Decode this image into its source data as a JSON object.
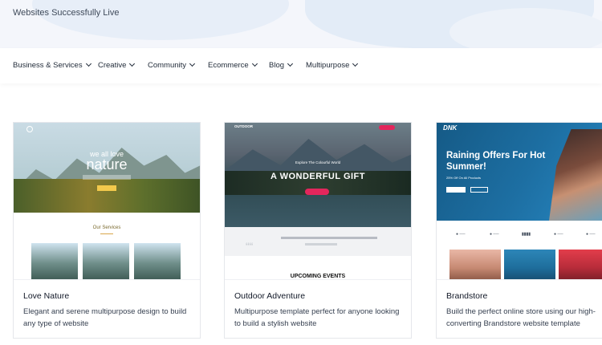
{
  "hero": {
    "text": "Websites Successfully Live"
  },
  "nav": {
    "items": [
      {
        "label": "Business & Services"
      },
      {
        "label": "Creative"
      },
      {
        "label": "Community"
      },
      {
        "label": "Ecommerce"
      },
      {
        "label": "Blog"
      },
      {
        "label": "Multipurpose"
      }
    ]
  },
  "cards": [
    {
      "title": "Love Nature",
      "description": "Elegant and serene multipurpose design to build any type of website",
      "preview": {
        "small": "we all love",
        "big": "nature",
        "section": "Our Services"
      }
    },
    {
      "title": "Outdoor Adventure",
      "description": "Multipurpose template perfect for anyone looking to build a stylish website",
      "preview": {
        "logo": "OUTDOOR",
        "small": "Explore The Colourful World",
        "big": "A WONDERFUL GIFT",
        "section": "UPCOMING EVENTS"
      }
    },
    {
      "title": "Brandstore",
      "description": "Build the perfect online store using our high-converting Brandstore website template",
      "preview": {
        "logo": "DNK",
        "big": "Raining Offers For Hot Summer!",
        "sub": "25% Off On All Products"
      }
    }
  ]
}
